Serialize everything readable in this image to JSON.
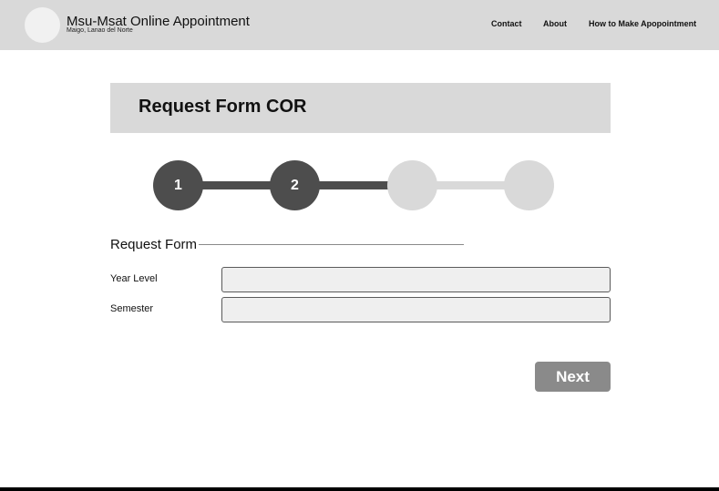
{
  "header": {
    "title": "Msu-Msat Online Appointment",
    "subtitle": "Maigo, Lanao del Norte",
    "nav": [
      {
        "label": "Contact"
      },
      {
        "label": "About"
      },
      {
        "label": "How to Make Apopointment"
      }
    ]
  },
  "page": {
    "title": "Request Form COR"
  },
  "stepper": {
    "current_step": 2,
    "total_steps": 4,
    "steps": [
      {
        "label": "1",
        "state": "done"
      },
      {
        "label": "2",
        "state": "done"
      },
      {
        "label": "",
        "state": "todo"
      },
      {
        "label": "",
        "state": "todo"
      }
    ]
  },
  "form": {
    "section_title": "Request Form",
    "fields": [
      {
        "label": "Year Level",
        "value": "",
        "placeholder": ""
      },
      {
        "label": "Semester",
        "value": "",
        "placeholder": ""
      }
    ],
    "next_label": "Next"
  },
  "colors": {
    "header_bg": "#d9d9d9",
    "step_active": "#4d4d4d",
    "step_inactive": "#d9d9d9",
    "button_bg": "#8a8a8a",
    "input_bg": "#efefef"
  }
}
